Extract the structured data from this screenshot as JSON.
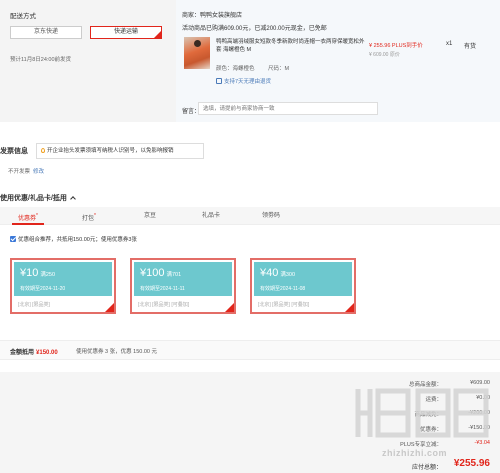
{
  "shipping": {
    "title": "配送方式",
    "options": [
      "京东快递",
      "快递运输"
    ],
    "selected_index": 1,
    "date_note": "预计11月8日24:00前发货"
  },
  "order": {
    "seller": "商家：鸭鸭女装旗舰店",
    "promo": "活动商品已购满609.00元，已减200.00元现金，已免邮",
    "product": {
      "name": "鸭鸭高端羽绒服女短款冬季新款时尚连帽一衣两穿保暖宽松外套 海螺橙色 M",
      "color_label": "颜色：",
      "color": "海螺橙色",
      "size_label": "尺码：",
      "size": "M",
      "return_note": "支持7天无理由退货",
      "price": "¥ 255.96 PLUS到手价",
      "orig_price": "¥ 609.00 原价",
      "qty": "x1",
      "stock": "有货"
    },
    "remark_label": "留言：",
    "remark_placeholder": "选填，请提前与商家协商一致"
  },
  "invoice": {
    "title": "发票信息",
    "tip": "开企业抬头发票须填写纳税人识别号，以免影响报销",
    "status": "不开发票",
    "edit": "修改"
  },
  "discounts": {
    "title": "使用优惠/礼品卡/抵用",
    "tabs": [
      {
        "label": "优惠券",
        "mark": "*"
      },
      {
        "label": "打包",
        "mark": "*"
      },
      {
        "label": "京豆",
        "mark": ""
      },
      {
        "label": "礼品卡",
        "mark": ""
      },
      {
        "label": "领劵码",
        "mark": ""
      }
    ],
    "combo_note": "优惠组合推荐，共抵用150.00元；使用优惠券3张",
    "coupons": [
      {
        "amount": "¥10",
        "cond": "满250",
        "valid": "有效期至2024-11-20",
        "links": "[北京]  [限品类]"
      },
      {
        "amount": "¥100",
        "cond": "满701",
        "valid": "有效期至2024-11-11",
        "links": "[北京]  [限品类]  [可叠加]"
      },
      {
        "amount": "¥40",
        "cond": "满300",
        "valid": "有效期至2024-11-08",
        "links": "[北京]  [限品类]  [可叠加]"
      }
    ]
  },
  "summary": {
    "label": "金额抵用",
    "amount": "¥150.00",
    "detail": "使用优惠券 3 张，优惠 150.00 元"
  },
  "totals": {
    "goods_label": "总商品金额：",
    "goods_value": "¥609.00",
    "rows": [
      {
        "label": "运费：",
        "value": "¥0.00"
      },
      {
        "label": "商品减免：",
        "value": "-¥200.00"
      },
      {
        "label": "优惠券：",
        "value": "-¥150.00"
      }
    ],
    "plus_label": "PLUS专享立减：",
    "plus_value": "-¥3.04",
    "pay_label": "应付总额：",
    "pay_value": "¥255.96"
  },
  "watermark": "zhizhizhi.com",
  "colors": {
    "accent": "#e1251b",
    "coupon_teal": "#6dc8ce",
    "link_blue": "#4a7ab8"
  }
}
